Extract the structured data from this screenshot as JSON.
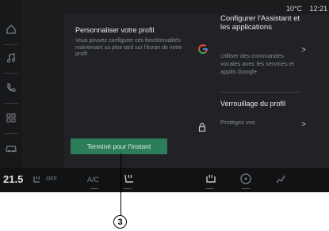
{
  "status": {
    "temperature": "10°C",
    "time": "12:21"
  },
  "sidebar": {
    "icons": [
      "home-icon",
      "music-icon",
      "phone-icon",
      "apps-icon",
      "car-icon"
    ]
  },
  "profile_card": {
    "title": "Personnaliser votre profil",
    "description": "Vous pouvez configurer ces fonctionnalités maintenant ou plus tard sur l'écran de votre profil"
  },
  "assistant_item": {
    "title": "Configurer l'Assistant et les applications",
    "description": "Utiliser des commandes vocales avec les services et applis Google",
    "chevron": ">"
  },
  "lock_item": {
    "title": "Verrouillage du profil",
    "description": "Protégez vos",
    "chevron": ">"
  },
  "done_button": {
    "label": "Terminé pour l'instant"
  },
  "bottom_bar": {
    "temperature": "21.5",
    "seat_heat_label": "OFF",
    "ac_label": "A/C"
  },
  "callout": {
    "label": "3"
  },
  "colors": {
    "accent": "#2e7d5a",
    "background": "#1a1c1e"
  }
}
